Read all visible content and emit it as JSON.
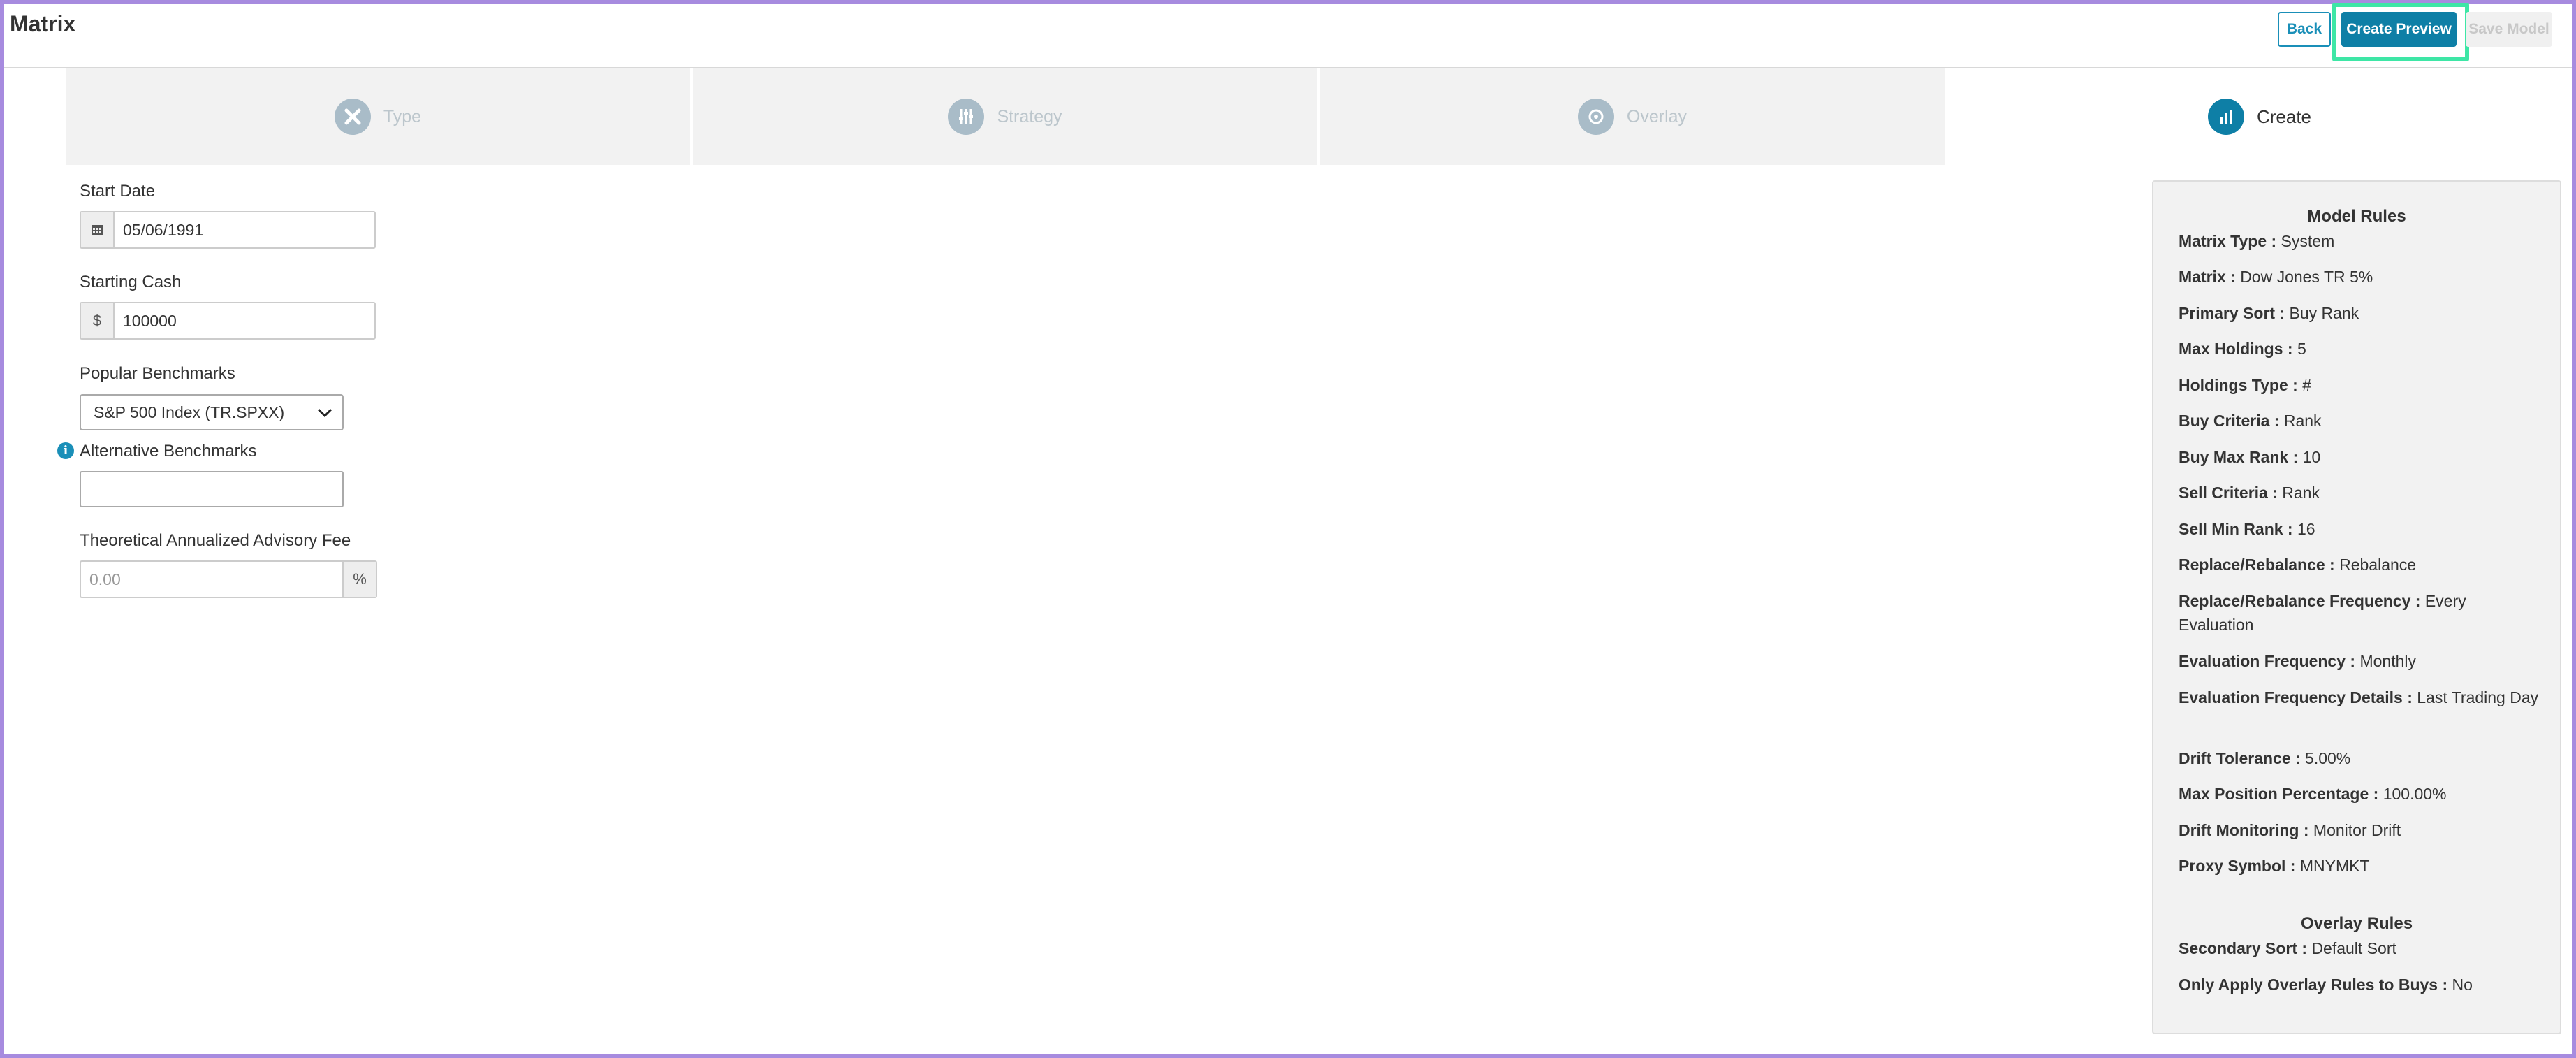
{
  "page_title": "Matrix",
  "toolbar": {
    "back_label": "Back",
    "create_preview_label": "Create Preview",
    "save_model_label": "Save Model"
  },
  "steps": [
    {
      "label": "Type",
      "icon": "wrench-screwdriver-icon",
      "active": false
    },
    {
      "label": "Strategy",
      "icon": "sliders-icon",
      "active": false
    },
    {
      "label": "Overlay",
      "icon": "overlay-circle-icon",
      "active": false
    },
    {
      "label": "Create",
      "icon": "bar-chart-icon",
      "active": true
    }
  ],
  "form": {
    "start_date_label": "Start Date",
    "start_date_value": "05/06/1991",
    "starting_cash_label": "Starting Cash",
    "currency_symbol": "$",
    "starting_cash_value": "100000",
    "popular_benchmarks_label": "Popular Benchmarks",
    "popular_benchmarks_selected": "S&P 500 Index (TR.SPXX)",
    "alternative_benchmarks_label": "Alternative Benchmarks",
    "alternative_benchmarks_value": "",
    "advisory_fee_label": "Theoretical Annualized Advisory Fee",
    "advisory_fee_placeholder": "0.00",
    "percent_symbol": "%"
  },
  "model_rules": {
    "title": "Model Rules",
    "items": [
      {
        "key": "Matrix Type :",
        "value": "System"
      },
      {
        "key": "Matrix :",
        "value": "Dow Jones TR 5%"
      },
      {
        "key": "Primary Sort :",
        "value": "Buy Rank"
      },
      {
        "key": "Max Holdings :",
        "value": "5"
      },
      {
        "key": "Holdings Type :",
        "value": "#"
      },
      {
        "key": "Buy Criteria :",
        "value": "Rank"
      },
      {
        "key": "Buy Max Rank :",
        "value": "10"
      },
      {
        "key": "Sell Criteria :",
        "value": "Rank"
      },
      {
        "key": "Sell Min Rank :",
        "value": "16"
      },
      {
        "key": "Replace/Rebalance :",
        "value": "Rebalance"
      },
      {
        "key": "Replace/Rebalance Frequency :",
        "value": "Every Evaluation"
      },
      {
        "key": "Evaluation Frequency :",
        "value": "Monthly"
      },
      {
        "key": "Evaluation Frequency Details :",
        "value": "Last Trading Day"
      },
      {
        "key": "Drift Tolerance :",
        "value": "5.00%"
      },
      {
        "key": "Max Position Percentage :",
        "value": "100.00%"
      },
      {
        "key": "Drift Monitoring :",
        "value": "Monitor Drift"
      },
      {
        "key": "Proxy Symbol :",
        "value": "MNYMKT"
      }
    ]
  },
  "overlay_rules": {
    "title": "Overlay Rules",
    "items": [
      {
        "key": "Secondary Sort :",
        "value": "Default Sort"
      },
      {
        "key": "Only Apply Overlay Rules to Buys :",
        "value": "No"
      }
    ]
  },
  "colors": {
    "accent": "#0e7fa6",
    "highlight": "#3ee6a6",
    "frame": "#a78bdf"
  }
}
